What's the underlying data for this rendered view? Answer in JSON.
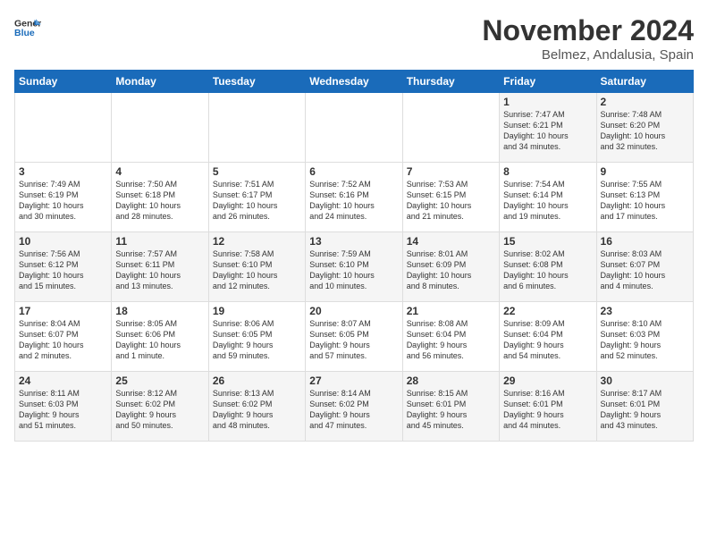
{
  "logo": {
    "line1": "General",
    "line2": "Blue"
  },
  "title": "November 2024",
  "location": "Belmez, Andalusia, Spain",
  "days_of_week": [
    "Sunday",
    "Monday",
    "Tuesday",
    "Wednesday",
    "Thursday",
    "Friday",
    "Saturday"
  ],
  "weeks": [
    [
      {
        "day": "",
        "detail": ""
      },
      {
        "day": "",
        "detail": ""
      },
      {
        "day": "",
        "detail": ""
      },
      {
        "day": "",
        "detail": ""
      },
      {
        "day": "",
        "detail": ""
      },
      {
        "day": "1",
        "detail": "Sunrise: 7:47 AM\nSunset: 6:21 PM\nDaylight: 10 hours\nand 34 minutes."
      },
      {
        "day": "2",
        "detail": "Sunrise: 7:48 AM\nSunset: 6:20 PM\nDaylight: 10 hours\nand 32 minutes."
      }
    ],
    [
      {
        "day": "3",
        "detail": "Sunrise: 7:49 AM\nSunset: 6:19 PM\nDaylight: 10 hours\nand 30 minutes."
      },
      {
        "day": "4",
        "detail": "Sunrise: 7:50 AM\nSunset: 6:18 PM\nDaylight: 10 hours\nand 28 minutes."
      },
      {
        "day": "5",
        "detail": "Sunrise: 7:51 AM\nSunset: 6:17 PM\nDaylight: 10 hours\nand 26 minutes."
      },
      {
        "day": "6",
        "detail": "Sunrise: 7:52 AM\nSunset: 6:16 PM\nDaylight: 10 hours\nand 24 minutes."
      },
      {
        "day": "7",
        "detail": "Sunrise: 7:53 AM\nSunset: 6:15 PM\nDaylight: 10 hours\nand 21 minutes."
      },
      {
        "day": "8",
        "detail": "Sunrise: 7:54 AM\nSunset: 6:14 PM\nDaylight: 10 hours\nand 19 minutes."
      },
      {
        "day": "9",
        "detail": "Sunrise: 7:55 AM\nSunset: 6:13 PM\nDaylight: 10 hours\nand 17 minutes."
      }
    ],
    [
      {
        "day": "10",
        "detail": "Sunrise: 7:56 AM\nSunset: 6:12 PM\nDaylight: 10 hours\nand 15 minutes."
      },
      {
        "day": "11",
        "detail": "Sunrise: 7:57 AM\nSunset: 6:11 PM\nDaylight: 10 hours\nand 13 minutes."
      },
      {
        "day": "12",
        "detail": "Sunrise: 7:58 AM\nSunset: 6:10 PM\nDaylight: 10 hours\nand 12 minutes."
      },
      {
        "day": "13",
        "detail": "Sunrise: 7:59 AM\nSunset: 6:10 PM\nDaylight: 10 hours\nand 10 minutes."
      },
      {
        "day": "14",
        "detail": "Sunrise: 8:01 AM\nSunset: 6:09 PM\nDaylight: 10 hours\nand 8 minutes."
      },
      {
        "day": "15",
        "detail": "Sunrise: 8:02 AM\nSunset: 6:08 PM\nDaylight: 10 hours\nand 6 minutes."
      },
      {
        "day": "16",
        "detail": "Sunrise: 8:03 AM\nSunset: 6:07 PM\nDaylight: 10 hours\nand 4 minutes."
      }
    ],
    [
      {
        "day": "17",
        "detail": "Sunrise: 8:04 AM\nSunset: 6:07 PM\nDaylight: 10 hours\nand 2 minutes."
      },
      {
        "day": "18",
        "detail": "Sunrise: 8:05 AM\nSunset: 6:06 PM\nDaylight: 10 hours\nand 1 minute."
      },
      {
        "day": "19",
        "detail": "Sunrise: 8:06 AM\nSunset: 6:05 PM\nDaylight: 9 hours\nand 59 minutes."
      },
      {
        "day": "20",
        "detail": "Sunrise: 8:07 AM\nSunset: 6:05 PM\nDaylight: 9 hours\nand 57 minutes."
      },
      {
        "day": "21",
        "detail": "Sunrise: 8:08 AM\nSunset: 6:04 PM\nDaylight: 9 hours\nand 56 minutes."
      },
      {
        "day": "22",
        "detail": "Sunrise: 8:09 AM\nSunset: 6:04 PM\nDaylight: 9 hours\nand 54 minutes."
      },
      {
        "day": "23",
        "detail": "Sunrise: 8:10 AM\nSunset: 6:03 PM\nDaylight: 9 hours\nand 52 minutes."
      }
    ],
    [
      {
        "day": "24",
        "detail": "Sunrise: 8:11 AM\nSunset: 6:03 PM\nDaylight: 9 hours\nand 51 minutes."
      },
      {
        "day": "25",
        "detail": "Sunrise: 8:12 AM\nSunset: 6:02 PM\nDaylight: 9 hours\nand 50 minutes."
      },
      {
        "day": "26",
        "detail": "Sunrise: 8:13 AM\nSunset: 6:02 PM\nDaylight: 9 hours\nand 48 minutes."
      },
      {
        "day": "27",
        "detail": "Sunrise: 8:14 AM\nSunset: 6:02 PM\nDaylight: 9 hours\nand 47 minutes."
      },
      {
        "day": "28",
        "detail": "Sunrise: 8:15 AM\nSunset: 6:01 PM\nDaylight: 9 hours\nand 45 minutes."
      },
      {
        "day": "29",
        "detail": "Sunrise: 8:16 AM\nSunset: 6:01 PM\nDaylight: 9 hours\nand 44 minutes."
      },
      {
        "day": "30",
        "detail": "Sunrise: 8:17 AM\nSunset: 6:01 PM\nDaylight: 9 hours\nand 43 minutes."
      }
    ]
  ]
}
